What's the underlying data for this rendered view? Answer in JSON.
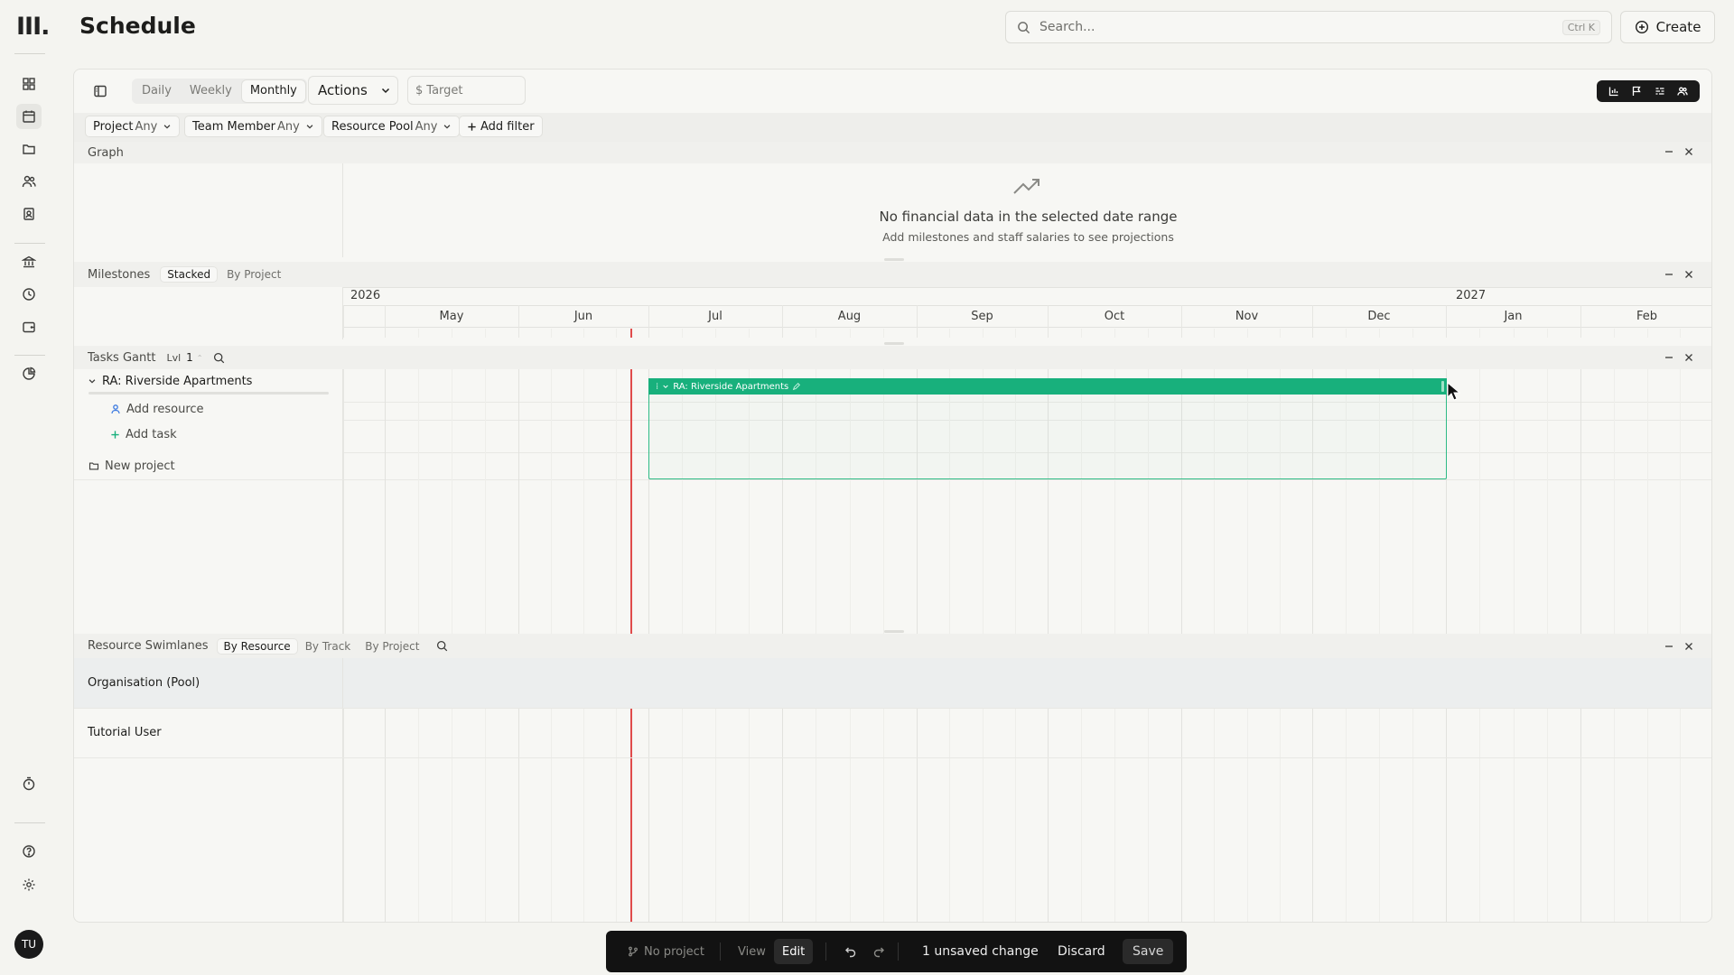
{
  "page": {
    "title": "Schedule"
  },
  "search": {
    "placeholder": "Search...",
    "shortcut": "Ctrl K"
  },
  "create_label": "Create",
  "toolbar": {
    "views": [
      "Daily",
      "Weekly",
      "Monthly"
    ],
    "active_view": "Monthly",
    "actions_label": "Actions",
    "target_label": "Target",
    "target_symbol": "$"
  },
  "filters": [
    {
      "label": "Project",
      "value": "Any"
    },
    {
      "label": "Team Member",
      "value": "Any"
    },
    {
      "label": "Resource Pool",
      "value": "Any"
    }
  ],
  "add_filter_label": "Add filter",
  "graph": {
    "title": "Graph",
    "empty_title": "No financial data in the selected date range",
    "empty_subtitle": "Add milestones and staff salaries to see projections"
  },
  "milestones": {
    "title": "Milestones",
    "modes": [
      "Stacked",
      "By Project"
    ],
    "active_mode": "Stacked"
  },
  "timeline": {
    "years": [
      "2026",
      "2027"
    ],
    "months": [
      "May",
      "Jun",
      "Jul",
      "Aug",
      "Sep",
      "Oct",
      "Nov",
      "Dec",
      "Jan",
      "Feb"
    ]
  },
  "tasks_gantt": {
    "title": "Tasks Gantt",
    "level_label": "Lvl",
    "level_value": "1",
    "project_name": "RA: Riverside Apartments",
    "bar_label": "RA: Riverside Apartments",
    "bar_start": "Jul 2026",
    "bar_end": "Dec 2026",
    "add_resource": "Add resource",
    "add_task": "Add task",
    "new_project": "New project"
  },
  "swimlanes": {
    "title": "Resource Swimlanes",
    "modes": [
      "By Resource",
      "By Track",
      "By Project"
    ],
    "active_mode": "By Resource",
    "rows": [
      "Organisation (Pool)",
      "Tutorial User"
    ]
  },
  "bottom_bar": {
    "project_label": "No project",
    "view_label": "View",
    "edit_label": "Edit",
    "changes_label": "1 unsaved change",
    "discard_label": "Discard",
    "save_label": "Save"
  },
  "user": {
    "initials": "TU"
  },
  "colors": {
    "accent": "#18b07c",
    "today_line": "#e04b4b",
    "bottom_bar": "#121212"
  }
}
